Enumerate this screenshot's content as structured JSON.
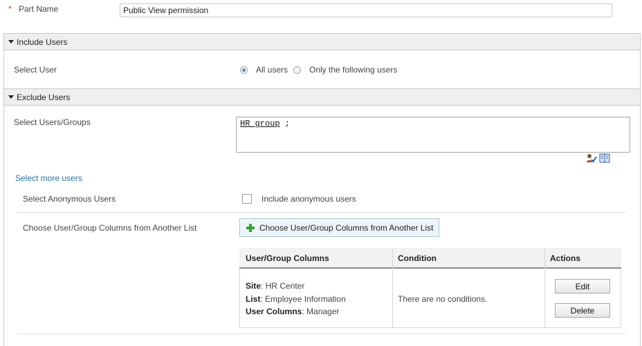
{
  "part": {
    "required_marker": "*",
    "label": "Part Name",
    "value": "Public View permission"
  },
  "include_users": {
    "header": "Include Users",
    "select_user_label": "Select User",
    "options": [
      {
        "label": "All users",
        "selected": true
      },
      {
        "label": "Only the following users",
        "selected": false
      }
    ]
  },
  "exclude_users": {
    "header": "Exclude Users",
    "select_groups_label": "Select Users/Groups",
    "picker_entity": "HR group",
    "picker_separator": " ;",
    "select_more_link": "Select more users",
    "anonymous_label": "Select Anonymous Users",
    "anonymous_checkbox_label": "Include anonymous users",
    "anonymous_checked": false,
    "columns_label": "Choose User/Group Columns from Another List",
    "columns_button": "Choose User/Group Columns from Another List",
    "table": {
      "headers": [
        "User/Group Columns",
        "Condition",
        "Actions"
      ],
      "row": {
        "site_key": "Site",
        "site_value": "HR Center",
        "list_key": "List",
        "list_value": "Employee Information",
        "columns_key": "User Columns",
        "columns_value": "Manager",
        "condition": "There are no conditions.",
        "edit_label": "Edit",
        "delete_label": "Delete"
      }
    }
  },
  "icons": {
    "caret": "caret-down-icon",
    "check_names": "user-check-icon",
    "browse": "address-book-icon",
    "add": "plus-icon"
  },
  "colors": {
    "link": "#2a6fa8",
    "header_bg": "#efefef",
    "radio_selected": "#5f88b8",
    "plus_green": "#3aa13a",
    "required_star": "#d04000"
  }
}
